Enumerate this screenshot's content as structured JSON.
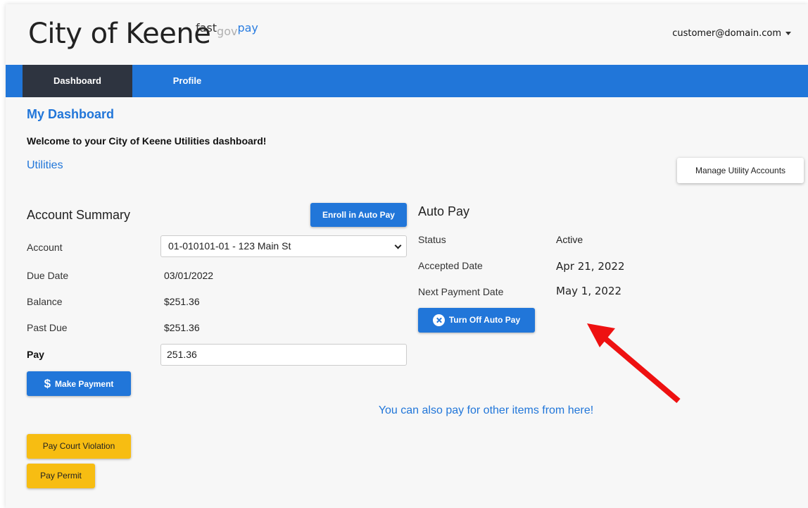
{
  "header": {
    "title": "City of Keene",
    "logo": {
      "part1": "fast",
      "part2": "gov",
      "part3": "pay"
    },
    "user_email": "customer@domain.com"
  },
  "nav": {
    "tabs": [
      {
        "label": "Dashboard",
        "active": true
      },
      {
        "label": "Profile",
        "active": false
      }
    ]
  },
  "main": {
    "title": "My Dashboard",
    "welcome": "Welcome to your City of Keene Utilities dashboard!",
    "utilities_link": "Utilities",
    "manage_button": "Manage Utility Accounts"
  },
  "account_summary": {
    "title": "Account Summary",
    "enroll_button": "Enroll in Auto Pay",
    "account_label": "Account",
    "account_value": "01-010101-01 -  123 Main St",
    "due_date_label": "Due Date",
    "due_date_value": "03/01/2022",
    "balance_label": "Balance",
    "balance_value": "$251.36",
    "past_due_label": "Past Due",
    "past_due_value": "$251.36",
    "pay_label": "Pay",
    "pay_value": "251.36",
    "make_payment_button": "Make Payment"
  },
  "auto_pay": {
    "title": "Auto Pay",
    "status_label": "Status",
    "status_value": "Active",
    "accepted_label": "Accepted Date",
    "accepted_value": "Apr 21, 2022",
    "next_label": "Next Payment Date",
    "next_value": "May 1, 2022",
    "turn_off_button": "Turn Off Auto Pay"
  },
  "other": {
    "message": "You can also pay for other items from here!",
    "court_button": "Pay Court Violation",
    "permit_button": "Pay Permit"
  },
  "colors": {
    "brand_blue": "#2176d9",
    "nav_active": "#2e3440",
    "yellow": "#f7bd12",
    "arrow_red": "#ee1111"
  },
  "icons": {
    "make_payment": "dollar-icon",
    "turn_off": "circle-x-icon",
    "user_menu": "caret-down-icon"
  }
}
